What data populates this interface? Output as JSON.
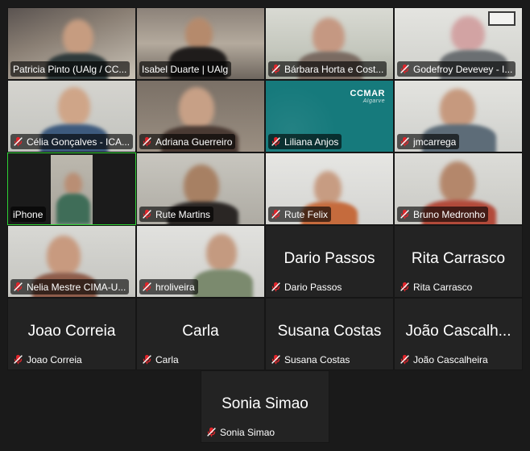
{
  "participants": [
    {
      "name": "Patricia Pinto (UAlg / CC...",
      "video": true,
      "muted": false
    },
    {
      "name": "Isabel Duarte | UAlg",
      "video": true,
      "muted": false
    },
    {
      "name": "Bárbara Horta e Cost...",
      "video": true,
      "muted": true
    },
    {
      "name": "Godefroy Devevey - I...",
      "video": true,
      "muted": true
    },
    {
      "name": "Célia Gonçalves - ICA...",
      "video": true,
      "muted": true
    },
    {
      "name": "Adriana Guerreiro",
      "video": true,
      "muted": true
    },
    {
      "name": "Liliana Anjos",
      "video": true,
      "muted": true,
      "logo_text": "CCMAR",
      "logo_sub": "Algarve"
    },
    {
      "name": "jmcarrega",
      "video": true,
      "muted": true
    },
    {
      "name": "iPhone",
      "video": true,
      "muted": false,
      "active_speaker": true
    },
    {
      "name": "Rute Martins",
      "video": true,
      "muted": true
    },
    {
      "name": "Rute Felix",
      "video": true,
      "muted": true
    },
    {
      "name": "Bruno Medronho",
      "video": true,
      "muted": true
    },
    {
      "name": "Nelia Mestre CIMA-U...",
      "video": true,
      "muted": true
    },
    {
      "name": "hroliveira",
      "video": true,
      "muted": true
    },
    {
      "name": "Dario Passos",
      "big_name": "Dario Passos",
      "video": false,
      "muted": true
    },
    {
      "name": "Rita Carrasco",
      "big_name": "Rita Carrasco",
      "video": false,
      "muted": true
    },
    {
      "name": "Joao Correia",
      "big_name": "Joao Correia",
      "video": false,
      "muted": true
    },
    {
      "name": "Carla",
      "big_name": "Carla",
      "video": false,
      "muted": true
    },
    {
      "name": "Susana Costas",
      "big_name": "Susana Costas",
      "video": false,
      "muted": true
    },
    {
      "name": "João Cascalheira",
      "big_name": "João Cascalh...",
      "video": false,
      "muted": true
    },
    {
      "name": "Sonia Simao",
      "big_name": "Sonia Simao",
      "video": false,
      "muted": true
    }
  ],
  "colors": {
    "background": "#1a1a1a",
    "tile": "#232323",
    "active_border": "#2ed134",
    "mute_icon": "#e0252b"
  }
}
